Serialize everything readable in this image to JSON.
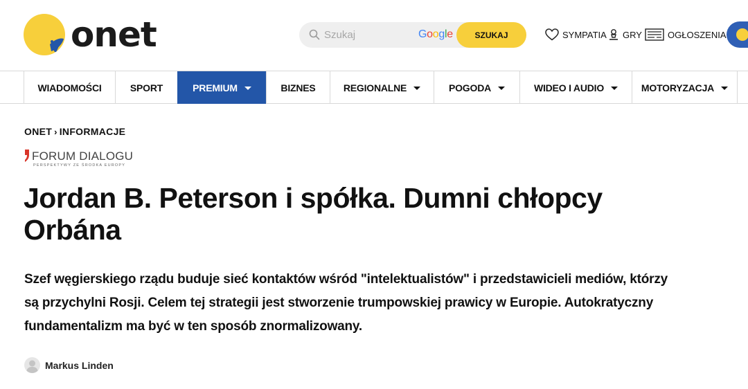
{
  "header": {
    "logo_text": "onet",
    "search": {
      "placeholder": "Szukaj",
      "value": "",
      "provider": "Google",
      "button_label": "SZUKAJ"
    },
    "links": [
      {
        "label": "SYMPATIA",
        "icon": "heart-icon"
      },
      {
        "label": "GRY",
        "icon": "game-icon"
      },
      {
        "label": "OGŁOSZENIA",
        "icon": "classifieds-icon"
      }
    ]
  },
  "nav": {
    "items": [
      {
        "label": "WIADOMOŚCI",
        "dropdown": false,
        "active": false
      },
      {
        "label": "SPORT",
        "dropdown": false,
        "active": false
      },
      {
        "label": "PREMIUM",
        "dropdown": true,
        "active": true
      },
      {
        "label": "BIZNES",
        "dropdown": false,
        "active": false
      },
      {
        "label": "REGIONALNE",
        "dropdown": true,
        "active": false
      },
      {
        "label": "POGODA",
        "dropdown": true,
        "active": false
      },
      {
        "label": "WIDEO I AUDIO",
        "dropdown": true,
        "active": false
      },
      {
        "label": "MOTORYZACJA",
        "dropdown": true,
        "active": false
      }
    ]
  },
  "breadcrumb": {
    "root": "ONET",
    "separator": "›",
    "section": "INFORMACJE"
  },
  "partner": {
    "name": "FORUM DIALOGU",
    "tagline": "PERSPEKTYWY ZE ŚRODKA EUROPY"
  },
  "article": {
    "title": "Jordan B. Peterson i spółka. Dumni chłopcy Orbána",
    "lead": "Szef węgierskiego rządu buduje sieć kontaktów wśród \"intelektualistów\" i przedstawicieli mediów, którzy są przychylni Rosji. Celem tej strategii jest stworzenie trumpowskiej prawicy w Europie. Autokratyczny fundamentalizm ma być w ten sposób znormalizowany.",
    "author": "Markus Linden"
  },
  "colors": {
    "brand_yellow": "#f7cf3b",
    "brand_blue": "#2356a8",
    "partner_red": "#d9352a"
  }
}
